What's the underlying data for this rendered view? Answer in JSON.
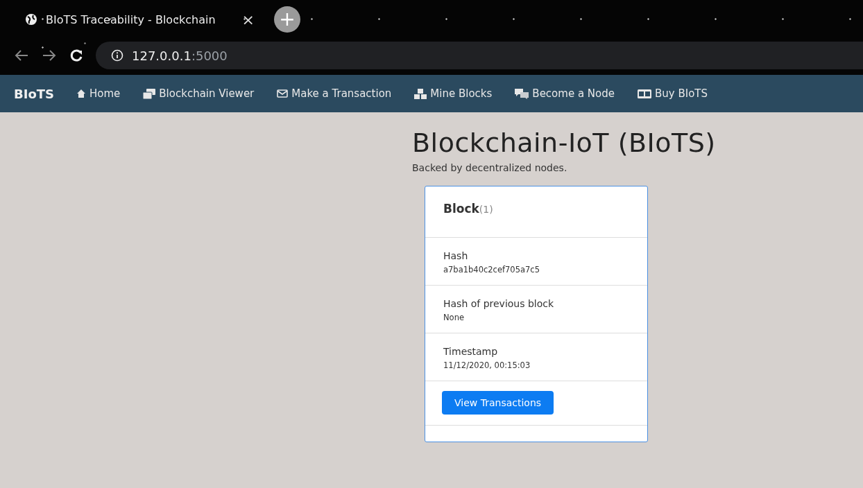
{
  "browser": {
    "tab_title": "BIoTS Traceability - Blockchain",
    "tab_close": "×",
    "new_tab": "+",
    "url_host": "127.0.0.1",
    "url_port": ":5000"
  },
  "navbar": {
    "brand": "BIoTS",
    "items": [
      {
        "label": "Home"
      },
      {
        "label": "Blockchain Viewer"
      },
      {
        "label": "Make a Transaction"
      },
      {
        "label": "Mine Blocks"
      },
      {
        "label": "Become a Node"
      },
      {
        "label": "Buy BIoTS"
      }
    ]
  },
  "header": {
    "title": "Blockchain-IoT (BIoTS)",
    "subtitle": "Backed by decentralized nodes."
  },
  "block_card": {
    "title": "Block",
    "count": "(1)",
    "fields": [
      {
        "label": "Hash",
        "value": "a7ba1b40c2cef705a7c5"
      },
      {
        "label": "Hash of previous block",
        "value": "None"
      },
      {
        "label": "Timestamp",
        "value": "11/12/2020, 00:15:03"
      }
    ],
    "button": "View Transactions"
  }
}
